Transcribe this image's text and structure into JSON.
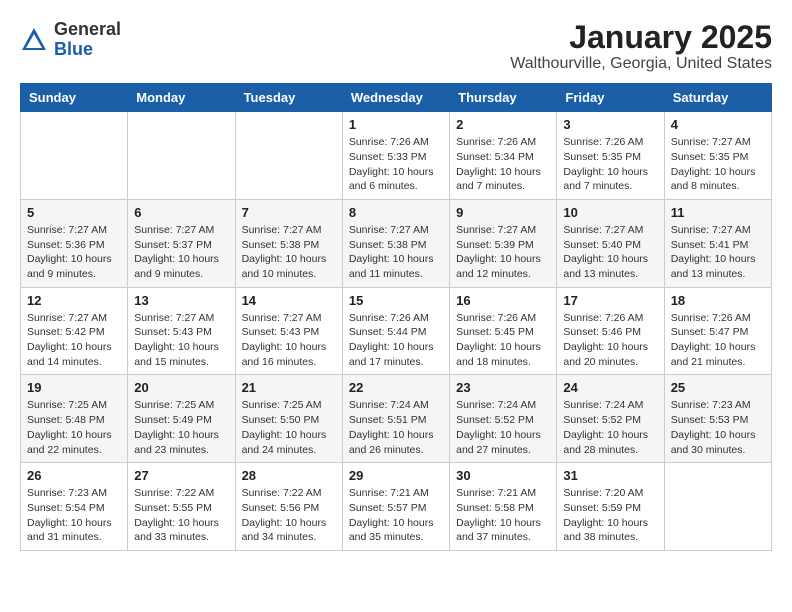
{
  "header": {
    "logo_general": "General",
    "logo_blue": "Blue",
    "month_title": "January 2025",
    "location": "Walthourville, Georgia, United States"
  },
  "weekdays": [
    "Sunday",
    "Monday",
    "Tuesday",
    "Wednesday",
    "Thursday",
    "Friday",
    "Saturday"
  ],
  "weeks": [
    [
      {
        "day": "",
        "info": ""
      },
      {
        "day": "",
        "info": ""
      },
      {
        "day": "",
        "info": ""
      },
      {
        "day": "1",
        "info": "Sunrise: 7:26 AM\nSunset: 5:33 PM\nDaylight: 10 hours\nand 6 minutes."
      },
      {
        "day": "2",
        "info": "Sunrise: 7:26 AM\nSunset: 5:34 PM\nDaylight: 10 hours\nand 7 minutes."
      },
      {
        "day": "3",
        "info": "Sunrise: 7:26 AM\nSunset: 5:35 PM\nDaylight: 10 hours\nand 7 minutes."
      },
      {
        "day": "4",
        "info": "Sunrise: 7:27 AM\nSunset: 5:35 PM\nDaylight: 10 hours\nand 8 minutes."
      }
    ],
    [
      {
        "day": "5",
        "info": "Sunrise: 7:27 AM\nSunset: 5:36 PM\nDaylight: 10 hours\nand 9 minutes."
      },
      {
        "day": "6",
        "info": "Sunrise: 7:27 AM\nSunset: 5:37 PM\nDaylight: 10 hours\nand 9 minutes."
      },
      {
        "day": "7",
        "info": "Sunrise: 7:27 AM\nSunset: 5:38 PM\nDaylight: 10 hours\nand 10 minutes."
      },
      {
        "day": "8",
        "info": "Sunrise: 7:27 AM\nSunset: 5:38 PM\nDaylight: 10 hours\nand 11 minutes."
      },
      {
        "day": "9",
        "info": "Sunrise: 7:27 AM\nSunset: 5:39 PM\nDaylight: 10 hours\nand 12 minutes."
      },
      {
        "day": "10",
        "info": "Sunrise: 7:27 AM\nSunset: 5:40 PM\nDaylight: 10 hours\nand 13 minutes."
      },
      {
        "day": "11",
        "info": "Sunrise: 7:27 AM\nSunset: 5:41 PM\nDaylight: 10 hours\nand 13 minutes."
      }
    ],
    [
      {
        "day": "12",
        "info": "Sunrise: 7:27 AM\nSunset: 5:42 PM\nDaylight: 10 hours\nand 14 minutes."
      },
      {
        "day": "13",
        "info": "Sunrise: 7:27 AM\nSunset: 5:43 PM\nDaylight: 10 hours\nand 15 minutes."
      },
      {
        "day": "14",
        "info": "Sunrise: 7:27 AM\nSunset: 5:43 PM\nDaylight: 10 hours\nand 16 minutes."
      },
      {
        "day": "15",
        "info": "Sunrise: 7:26 AM\nSunset: 5:44 PM\nDaylight: 10 hours\nand 17 minutes."
      },
      {
        "day": "16",
        "info": "Sunrise: 7:26 AM\nSunset: 5:45 PM\nDaylight: 10 hours\nand 18 minutes."
      },
      {
        "day": "17",
        "info": "Sunrise: 7:26 AM\nSunset: 5:46 PM\nDaylight: 10 hours\nand 20 minutes."
      },
      {
        "day": "18",
        "info": "Sunrise: 7:26 AM\nSunset: 5:47 PM\nDaylight: 10 hours\nand 21 minutes."
      }
    ],
    [
      {
        "day": "19",
        "info": "Sunrise: 7:25 AM\nSunset: 5:48 PM\nDaylight: 10 hours\nand 22 minutes."
      },
      {
        "day": "20",
        "info": "Sunrise: 7:25 AM\nSunset: 5:49 PM\nDaylight: 10 hours\nand 23 minutes."
      },
      {
        "day": "21",
        "info": "Sunrise: 7:25 AM\nSunset: 5:50 PM\nDaylight: 10 hours\nand 24 minutes."
      },
      {
        "day": "22",
        "info": "Sunrise: 7:24 AM\nSunset: 5:51 PM\nDaylight: 10 hours\nand 26 minutes."
      },
      {
        "day": "23",
        "info": "Sunrise: 7:24 AM\nSunset: 5:52 PM\nDaylight: 10 hours\nand 27 minutes."
      },
      {
        "day": "24",
        "info": "Sunrise: 7:24 AM\nSunset: 5:52 PM\nDaylight: 10 hours\nand 28 minutes."
      },
      {
        "day": "25",
        "info": "Sunrise: 7:23 AM\nSunset: 5:53 PM\nDaylight: 10 hours\nand 30 minutes."
      }
    ],
    [
      {
        "day": "26",
        "info": "Sunrise: 7:23 AM\nSunset: 5:54 PM\nDaylight: 10 hours\nand 31 minutes."
      },
      {
        "day": "27",
        "info": "Sunrise: 7:22 AM\nSunset: 5:55 PM\nDaylight: 10 hours\nand 33 minutes."
      },
      {
        "day": "28",
        "info": "Sunrise: 7:22 AM\nSunset: 5:56 PM\nDaylight: 10 hours\nand 34 minutes."
      },
      {
        "day": "29",
        "info": "Sunrise: 7:21 AM\nSunset: 5:57 PM\nDaylight: 10 hours\nand 35 minutes."
      },
      {
        "day": "30",
        "info": "Sunrise: 7:21 AM\nSunset: 5:58 PM\nDaylight: 10 hours\nand 37 minutes."
      },
      {
        "day": "31",
        "info": "Sunrise: 7:20 AM\nSunset: 5:59 PM\nDaylight: 10 hours\nand 38 minutes."
      },
      {
        "day": "",
        "info": ""
      }
    ]
  ]
}
